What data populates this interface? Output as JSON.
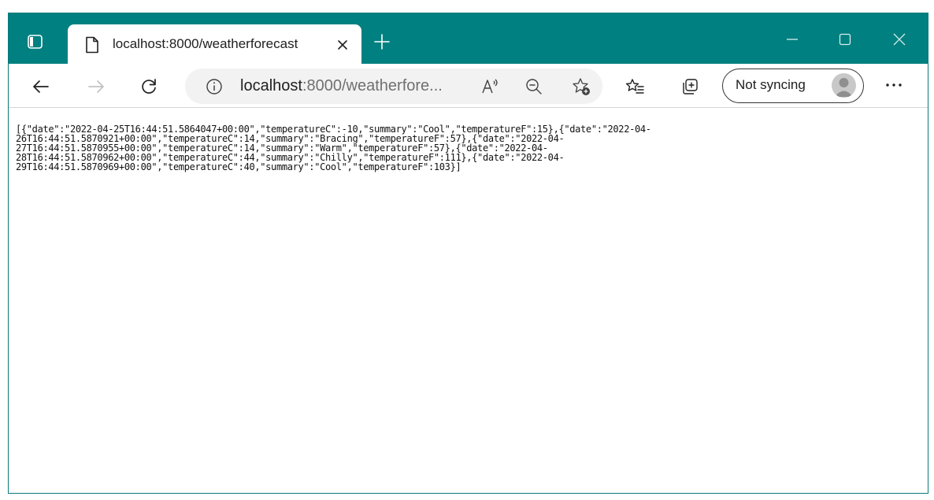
{
  "browser": {
    "tab": {
      "title": "localhost:8000/weatherforecast"
    },
    "address": {
      "host": "localhost",
      "rest": ":8000/weatherfore...",
      "full_url": "localhost:8000/weatherforecast"
    },
    "profile": {
      "label": "Not syncing"
    },
    "icons": {
      "tab_actions": "tab-actions-icon",
      "page": "page-icon",
      "close_tab": "close-icon",
      "new_tab": "plus-icon",
      "minimize": "minimize-icon",
      "maximize": "maximize-icon",
      "close_window": "close-icon",
      "back": "back-arrow-icon",
      "forward": "forward-arrow-icon",
      "refresh": "refresh-icon",
      "site_info": "info-icon",
      "read_aloud": "read-aloud-icon",
      "zoom_out": "zoom-out-icon",
      "add_favorite": "star-plus-icon",
      "favorites": "favorites-icon",
      "collections": "collections-icon",
      "avatar": "avatar-icon",
      "more": "more-icon"
    },
    "colors": {
      "titlebar": "#008080",
      "addressbar": "#f2f2f2"
    }
  },
  "page": {
    "json_lines": [
      "[{\"date\":\"2022-04-25T16:44:51.5864047+00:00\",\"temperatureC\":-10,\"summary\":\"Cool\",\"temperatureF\":15},{\"date\":\"2022-04-",
      "26T16:44:51.5870921+00:00\",\"temperatureC\":14,\"summary\":\"Bracing\",\"temperatureF\":57},{\"date\":\"2022-04-",
      "27T16:44:51.5870955+00:00\",\"temperatureC\":14,\"summary\":\"Warm\",\"temperatureF\":57},{\"date\":\"2022-04-",
      "28T16:44:51.5870962+00:00\",\"temperatureC\":44,\"summary\":\"Chilly\",\"temperatureF\":111},{\"date\":\"2022-04-",
      "29T16:44:51.5870969+00:00\",\"temperatureC\":40,\"summary\":\"Cool\",\"temperatureF\":103}]"
    ]
  }
}
